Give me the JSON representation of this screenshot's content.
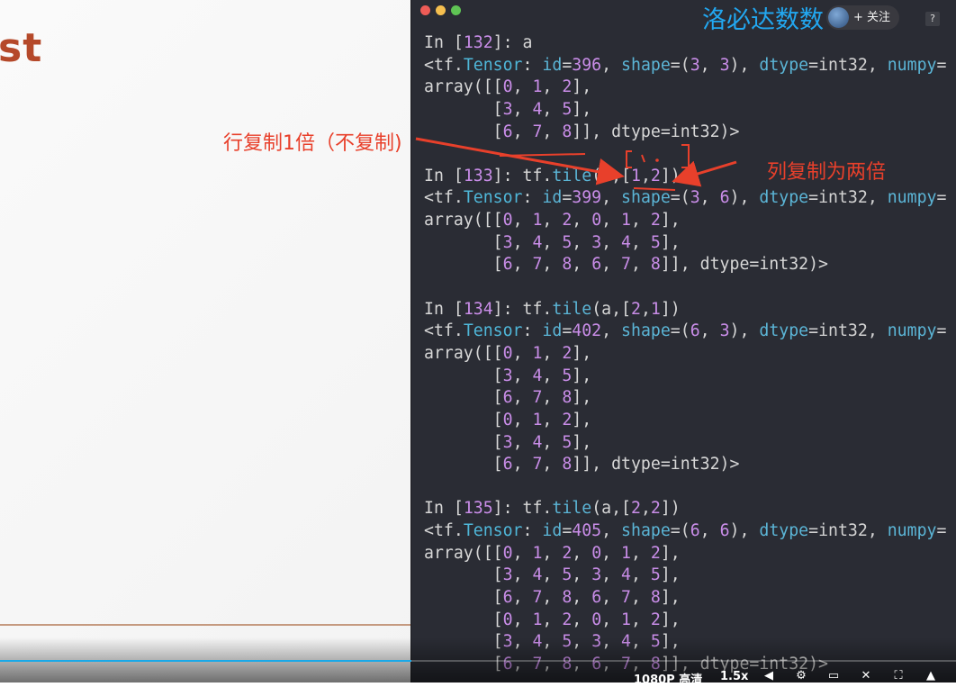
{
  "slide": {
    "title_fragment": "st"
  },
  "terminal": {
    "lines": [
      [
        [
          "In [",
          "pp"
        ],
        [
          "132",
          "n"
        ],
        [
          "]: a",
          "pp"
        ]
      ],
      [
        [
          "<",
          "pp"
        ],
        [
          "tf",
          "pp"
        ],
        [
          ".",
          "pp"
        ],
        [
          "Tensor",
          "cls"
        ],
        [
          ": ",
          "pp"
        ],
        [
          "id",
          "kw"
        ],
        [
          "=",
          "eq"
        ],
        [
          "396",
          "n"
        ],
        [
          ", ",
          "pp"
        ],
        [
          "shape",
          "kw"
        ],
        [
          "=(",
          "eq"
        ],
        [
          "3",
          "n"
        ],
        [
          ", ",
          "pp"
        ],
        [
          "3",
          "n"
        ],
        [
          "), ",
          "pp"
        ],
        [
          "dtype",
          "kw"
        ],
        [
          "=int32, ",
          "eq"
        ],
        [
          "numpy",
          "kw"
        ],
        [
          "=",
          "eq"
        ]
      ],
      [
        [
          "array([[",
          "pp"
        ],
        [
          "0",
          "n"
        ],
        [
          ", ",
          "pp"
        ],
        [
          "1",
          "n"
        ],
        [
          ", ",
          "pp"
        ],
        [
          "2",
          "n"
        ],
        [
          "],",
          "pp"
        ]
      ],
      [
        [
          "       [",
          "pp"
        ],
        [
          "3",
          "n"
        ],
        [
          ", ",
          "pp"
        ],
        [
          "4",
          "n"
        ],
        [
          ", ",
          "pp"
        ],
        [
          "5",
          "n"
        ],
        [
          "],",
          "pp"
        ]
      ],
      [
        [
          "       [",
          "pp"
        ],
        [
          "6",
          "n"
        ],
        [
          ", ",
          "pp"
        ],
        [
          "7",
          "n"
        ],
        [
          ", ",
          "pp"
        ],
        [
          "8",
          "n"
        ],
        [
          "]], dtype=int32)>",
          "pp"
        ]
      ],
      [
        [
          "",
          "pp"
        ]
      ],
      [
        [
          "In [",
          "pp"
        ],
        [
          "133",
          "n"
        ],
        [
          "]: tf.",
          "pp"
        ],
        [
          "tile",
          "kw"
        ],
        [
          "(a,[",
          "pp"
        ],
        [
          "1",
          "n"
        ],
        [
          ",",
          "pp"
        ],
        [
          "2",
          "n"
        ],
        [
          "])",
          "pp"
        ]
      ],
      [
        [
          "<",
          "pp"
        ],
        [
          "tf",
          "pp"
        ],
        [
          ".",
          "pp"
        ],
        [
          "Tensor",
          "cls"
        ],
        [
          ": ",
          "pp"
        ],
        [
          "id",
          "kw"
        ],
        [
          "=",
          "eq"
        ],
        [
          "399",
          "n"
        ],
        [
          ", ",
          "pp"
        ],
        [
          "shape",
          "kw"
        ],
        [
          "=(",
          "eq"
        ],
        [
          "3",
          "n"
        ],
        [
          ", ",
          "pp"
        ],
        [
          "6",
          "n"
        ],
        [
          "), ",
          "pp"
        ],
        [
          "dtype",
          "kw"
        ],
        [
          "=int32, ",
          "eq"
        ],
        [
          "numpy",
          "kw"
        ],
        [
          "=",
          "eq"
        ]
      ],
      [
        [
          "array([[",
          "pp"
        ],
        [
          "0",
          "n"
        ],
        [
          ", ",
          "pp"
        ],
        [
          "1",
          "n"
        ],
        [
          ", ",
          "pp"
        ],
        [
          "2",
          "n"
        ],
        [
          ", ",
          "pp"
        ],
        [
          "0",
          "n"
        ],
        [
          ", ",
          "pp"
        ],
        [
          "1",
          "n"
        ],
        [
          ", ",
          "pp"
        ],
        [
          "2",
          "n"
        ],
        [
          "],",
          "pp"
        ]
      ],
      [
        [
          "       [",
          "pp"
        ],
        [
          "3",
          "n"
        ],
        [
          ", ",
          "pp"
        ],
        [
          "4",
          "n"
        ],
        [
          ", ",
          "pp"
        ],
        [
          "5",
          "n"
        ],
        [
          ", ",
          "pp"
        ],
        [
          "3",
          "n"
        ],
        [
          ", ",
          "pp"
        ],
        [
          "4",
          "n"
        ],
        [
          ", ",
          "pp"
        ],
        [
          "5",
          "n"
        ],
        [
          "],",
          "pp"
        ]
      ],
      [
        [
          "       [",
          "pp"
        ],
        [
          "6",
          "n"
        ],
        [
          ", ",
          "pp"
        ],
        [
          "7",
          "n"
        ],
        [
          ", ",
          "pp"
        ],
        [
          "8",
          "n"
        ],
        [
          ", ",
          "pp"
        ],
        [
          "6",
          "n"
        ],
        [
          ", ",
          "pp"
        ],
        [
          "7",
          "n"
        ],
        [
          ", ",
          "pp"
        ],
        [
          "8",
          "n"
        ],
        [
          "]], dtype=int32)>",
          "pp"
        ]
      ],
      [
        [
          "",
          "pp"
        ]
      ],
      [
        [
          "In [",
          "pp"
        ],
        [
          "134",
          "n"
        ],
        [
          "]: tf.",
          "pp"
        ],
        [
          "tile",
          "kw"
        ],
        [
          "(a,[",
          "pp"
        ],
        [
          "2",
          "n"
        ],
        [
          ",",
          "pp"
        ],
        [
          "1",
          "n"
        ],
        [
          "])",
          "pp"
        ]
      ],
      [
        [
          "<",
          "pp"
        ],
        [
          "tf",
          "pp"
        ],
        [
          ".",
          "pp"
        ],
        [
          "Tensor",
          "cls"
        ],
        [
          ": ",
          "pp"
        ],
        [
          "id",
          "kw"
        ],
        [
          "=",
          "eq"
        ],
        [
          "402",
          "n"
        ],
        [
          ", ",
          "pp"
        ],
        [
          "shape",
          "kw"
        ],
        [
          "=(",
          "eq"
        ],
        [
          "6",
          "n"
        ],
        [
          ", ",
          "pp"
        ],
        [
          "3",
          "n"
        ],
        [
          "), ",
          "pp"
        ],
        [
          "dtype",
          "kw"
        ],
        [
          "=int32, ",
          "eq"
        ],
        [
          "numpy",
          "kw"
        ],
        [
          "=",
          "eq"
        ]
      ],
      [
        [
          "array([[",
          "pp"
        ],
        [
          "0",
          "n"
        ],
        [
          ", ",
          "pp"
        ],
        [
          "1",
          "n"
        ],
        [
          ", ",
          "pp"
        ],
        [
          "2",
          "n"
        ],
        [
          "],",
          "pp"
        ]
      ],
      [
        [
          "       [",
          "pp"
        ],
        [
          "3",
          "n"
        ],
        [
          ", ",
          "pp"
        ],
        [
          "4",
          "n"
        ],
        [
          ", ",
          "pp"
        ],
        [
          "5",
          "n"
        ],
        [
          "],",
          "pp"
        ]
      ],
      [
        [
          "       [",
          "pp"
        ],
        [
          "6",
          "n"
        ],
        [
          ", ",
          "pp"
        ],
        [
          "7",
          "n"
        ],
        [
          ", ",
          "pp"
        ],
        [
          "8",
          "n"
        ],
        [
          "],",
          "pp"
        ]
      ],
      [
        [
          "       [",
          "pp"
        ],
        [
          "0",
          "n"
        ],
        [
          ", ",
          "pp"
        ],
        [
          "1",
          "n"
        ],
        [
          ", ",
          "pp"
        ],
        [
          "2",
          "n"
        ],
        [
          "],",
          "pp"
        ]
      ],
      [
        [
          "       [",
          "pp"
        ],
        [
          "3",
          "n"
        ],
        [
          ", ",
          "pp"
        ],
        [
          "4",
          "n"
        ],
        [
          ", ",
          "pp"
        ],
        [
          "5",
          "n"
        ],
        [
          "],",
          "pp"
        ]
      ],
      [
        [
          "       [",
          "pp"
        ],
        [
          "6",
          "n"
        ],
        [
          ", ",
          "pp"
        ],
        [
          "7",
          "n"
        ],
        [
          ", ",
          "pp"
        ],
        [
          "8",
          "n"
        ],
        [
          "]], dtype=int32)>",
          "pp"
        ]
      ],
      [
        [
          "",
          "pp"
        ]
      ],
      [
        [
          "In [",
          "pp"
        ],
        [
          "135",
          "n"
        ],
        [
          "]: tf.",
          "pp"
        ],
        [
          "tile",
          "kw"
        ],
        [
          "(a,[",
          "pp"
        ],
        [
          "2",
          "n"
        ],
        [
          ",",
          "pp"
        ],
        [
          "2",
          "n"
        ],
        [
          "])",
          "pp"
        ]
      ],
      [
        [
          "<",
          "pp"
        ],
        [
          "tf",
          "pp"
        ],
        [
          ".",
          "pp"
        ],
        [
          "Tensor",
          "cls"
        ],
        [
          ": ",
          "pp"
        ],
        [
          "id",
          "kw"
        ],
        [
          "=",
          "eq"
        ],
        [
          "405",
          "n"
        ],
        [
          ", ",
          "pp"
        ],
        [
          "shape",
          "kw"
        ],
        [
          "=(",
          "eq"
        ],
        [
          "6",
          "n"
        ],
        [
          ", ",
          "pp"
        ],
        [
          "6",
          "n"
        ],
        [
          "), ",
          "pp"
        ],
        [
          "dtype",
          "kw"
        ],
        [
          "=int32, ",
          "eq"
        ],
        [
          "numpy",
          "kw"
        ],
        [
          "=",
          "eq"
        ]
      ],
      [
        [
          "array([[",
          "pp"
        ],
        [
          "0",
          "n"
        ],
        [
          ", ",
          "pp"
        ],
        [
          "1",
          "n"
        ],
        [
          ", ",
          "pp"
        ],
        [
          "2",
          "n"
        ],
        [
          ", ",
          "pp"
        ],
        [
          "0",
          "n"
        ],
        [
          ", ",
          "pp"
        ],
        [
          "1",
          "n"
        ],
        [
          ", ",
          "pp"
        ],
        [
          "2",
          "n"
        ],
        [
          "],",
          "pp"
        ]
      ],
      [
        [
          "       [",
          "pp"
        ],
        [
          "3",
          "n"
        ],
        [
          ", ",
          "pp"
        ],
        [
          "4",
          "n"
        ],
        [
          ", ",
          "pp"
        ],
        [
          "5",
          "n"
        ],
        [
          ", ",
          "pp"
        ],
        [
          "3",
          "n"
        ],
        [
          ", ",
          "pp"
        ],
        [
          "4",
          "n"
        ],
        [
          ", ",
          "pp"
        ],
        [
          "5",
          "n"
        ],
        [
          "],",
          "pp"
        ]
      ],
      [
        [
          "       [",
          "pp"
        ],
        [
          "6",
          "n"
        ],
        [
          ", ",
          "pp"
        ],
        [
          "7",
          "n"
        ],
        [
          ", ",
          "pp"
        ],
        [
          "8",
          "n"
        ],
        [
          ", ",
          "pp"
        ],
        [
          "6",
          "n"
        ],
        [
          ", ",
          "pp"
        ],
        [
          "7",
          "n"
        ],
        [
          ", ",
          "pp"
        ],
        [
          "8",
          "n"
        ],
        [
          "],",
          "pp"
        ]
      ],
      [
        [
          "       [",
          "pp"
        ],
        [
          "0",
          "n"
        ],
        [
          ", ",
          "pp"
        ],
        [
          "1",
          "n"
        ],
        [
          ", ",
          "pp"
        ],
        [
          "2",
          "n"
        ],
        [
          ", ",
          "pp"
        ],
        [
          "0",
          "n"
        ],
        [
          ", ",
          "pp"
        ],
        [
          "1",
          "n"
        ],
        [
          ", ",
          "pp"
        ],
        [
          "2",
          "n"
        ],
        [
          "],",
          "pp"
        ]
      ],
      [
        [
          "       [",
          "pp"
        ],
        [
          "3",
          "n"
        ],
        [
          ", ",
          "pp"
        ],
        [
          "4",
          "n"
        ],
        [
          ", ",
          "pp"
        ],
        [
          "5",
          "n"
        ],
        [
          ", ",
          "pp"
        ],
        [
          "3",
          "n"
        ],
        [
          ", ",
          "pp"
        ],
        [
          "4",
          "n"
        ],
        [
          ", ",
          "pp"
        ],
        [
          "5",
          "n"
        ],
        [
          "],",
          "pp"
        ]
      ],
      [
        [
          "       [",
          "pp"
        ],
        [
          "6",
          "n"
        ],
        [
          ", ",
          "pp"
        ],
        [
          "7",
          "n"
        ],
        [
          ", ",
          "pp"
        ],
        [
          "8",
          "n"
        ],
        [
          ", ",
          "pp"
        ],
        [
          "6",
          "n"
        ],
        [
          ", ",
          "pp"
        ],
        [
          "7",
          "n"
        ],
        [
          ", ",
          "pp"
        ],
        [
          "8",
          "n"
        ],
        [
          "]], dtype=int32)>",
          "pp"
        ]
      ]
    ]
  },
  "watermark": {
    "channel": "洛必达数数",
    "follow_label": "+ 关注",
    "help": "?"
  },
  "annotations": {
    "row_note": "行复制1倍（不复制)",
    "col_note": "列复制为两倍",
    "handwriting": "[ ] ."
  },
  "player": {
    "quality": "1080P 高清",
    "speed": "1.5x",
    "progress": 0.43,
    "icons": [
      "volume-icon",
      "settings-icon",
      "danmaku-icon",
      "close-danmaku-icon",
      "fullscreen-web-icon",
      "fullscreen-icon"
    ]
  },
  "colors": {
    "terminal_bg": "#2a2c34",
    "annotation_red": "#e8402b",
    "watermark_blue": "#22a7f0",
    "accent_progress": "#1aa9e8"
  }
}
